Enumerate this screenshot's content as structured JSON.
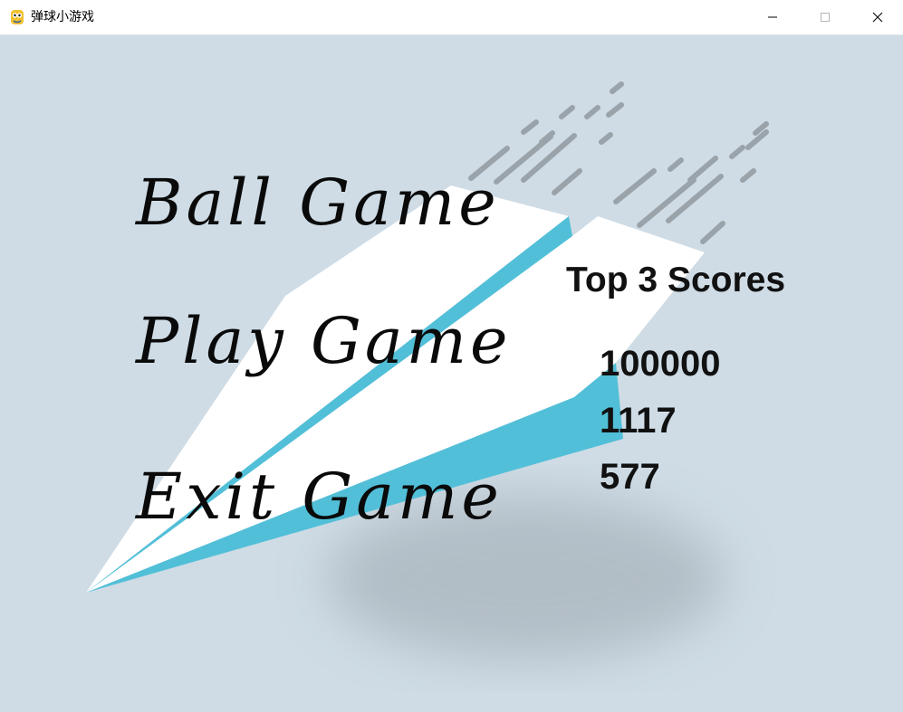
{
  "window": {
    "title": "弹球小游戏",
    "icon": "python-snake-icon",
    "controls": [
      "minimize-icon",
      "maximize-icon",
      "close-icon"
    ]
  },
  "menu": {
    "title": "Ball Game",
    "play": "Play Game",
    "exit": "Exit Game"
  },
  "scores": {
    "heading": "Top 3 Scores",
    "values": [
      "100000",
      "1117",
      "577"
    ]
  },
  "colors": {
    "background": "#cfdce5",
    "plane_white": "#ffffff",
    "plane_blue": "#52bfd8",
    "speed_lines": "#9aa3aa",
    "text": "#111111"
  }
}
